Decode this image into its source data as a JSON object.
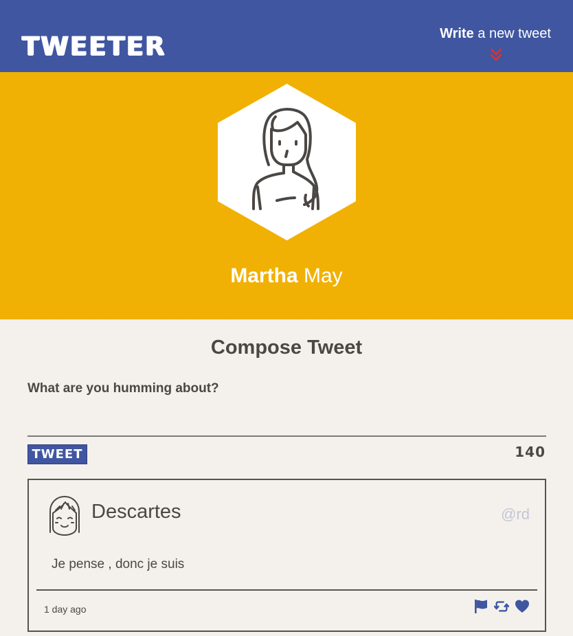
{
  "nav": {
    "brand": "TWEETER",
    "write_bold": "Write",
    "write_rest": " a new tweet",
    "chevron_icon": "double-chevron-down-icon",
    "chevron_color": "#e0322c"
  },
  "header": {
    "first_name": "Martha",
    "last_name": " May",
    "background_color": "#f1b104",
    "avatar_icon": "woman-avatar-icon"
  },
  "compose": {
    "title": "Compose Tweet",
    "label": "What are you humming about?",
    "input_value": "",
    "button_label": "TWEET",
    "counter": "140"
  },
  "tweet": {
    "author": "Descartes",
    "handle": "@rd",
    "content": "Je pense , donc je suis",
    "timestamp": "1 day ago",
    "avatar_icon": "girl-avatar-icon",
    "actions": [
      "flag-icon",
      "retweet-icon",
      "heart-icon"
    ],
    "action_color": "#4056a1"
  },
  "colors": {
    "nav": "#4056a1",
    "page_bg": "#f4f1ec",
    "text": "#4a4744"
  }
}
